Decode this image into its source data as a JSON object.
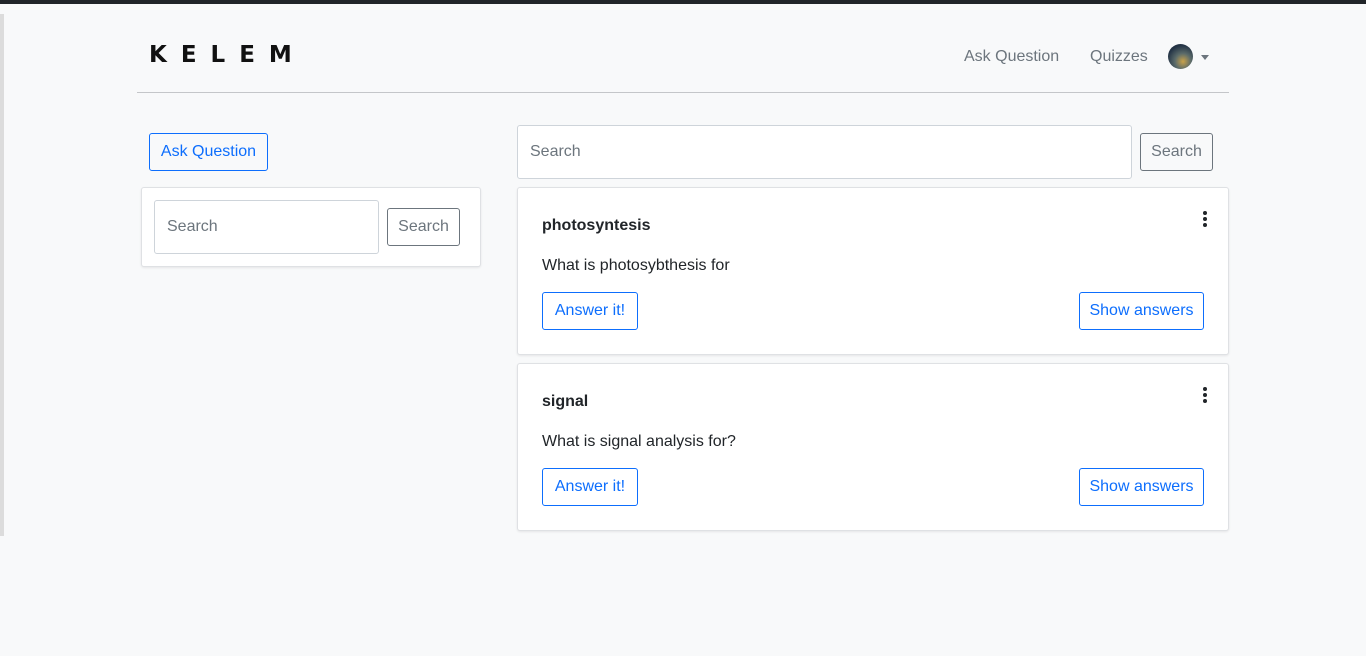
{
  "nav": {
    "brand": "KELEM",
    "links": [
      "Ask Question",
      "Quizzes"
    ],
    "avatar_icon": "user-avatar"
  },
  "sidebar": {
    "ask_button": "Ask Question",
    "search": {
      "placeholder": "Search",
      "button": "Search"
    }
  },
  "main_search": {
    "placeholder": "Search",
    "button": "Search"
  },
  "questions": [
    {
      "title": "photosyntesis",
      "body": "What is photosybthesis for",
      "answer_button": "Answer it!",
      "show_button": "Show answers"
    },
    {
      "title": "signal",
      "body": "What is signal analysis for?",
      "answer_button": "Answer it!",
      "show_button": "Show answers"
    }
  ],
  "colors": {
    "primary": "#0d6efd",
    "secondary": "#6c757d",
    "background": "#f8f9fa"
  }
}
